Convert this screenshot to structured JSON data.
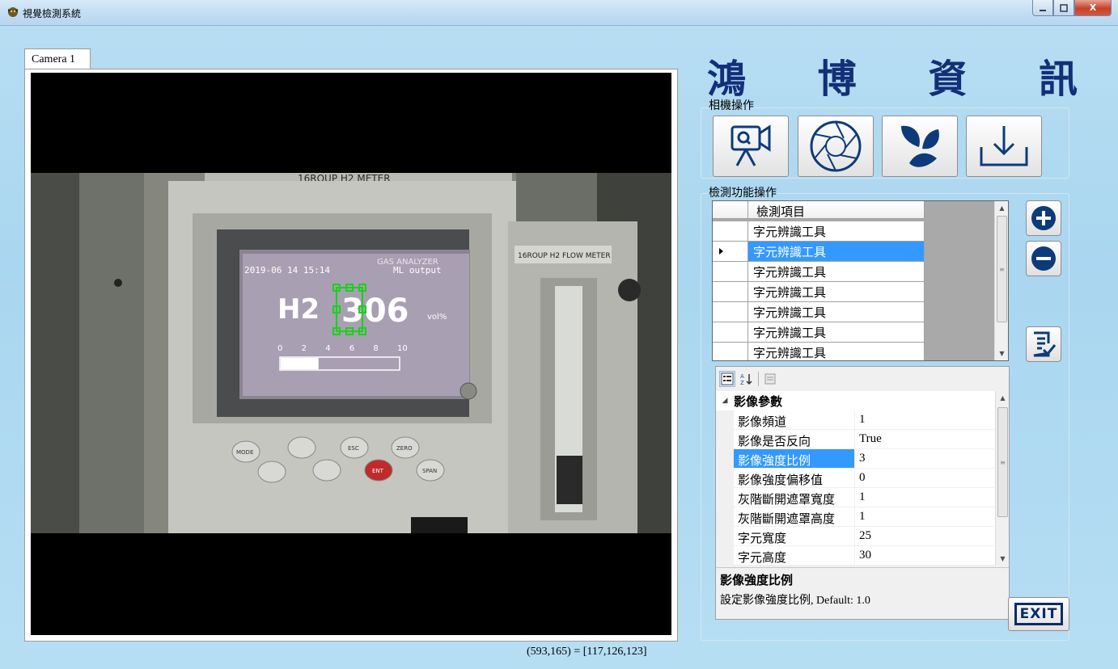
{
  "window": {
    "title": "視覺檢測系統",
    "minimize_icon": "minimize-icon",
    "maximize_icon": "maximize-icon",
    "close_label": "X"
  },
  "camera": {
    "tab_label": "Camera 1",
    "image": {
      "meter_top_label": "16ROUP H2 METER",
      "flow_meter_label": "16ROUP H2 FLOW METER",
      "analyzer_label": "GAS ANALYZER",
      "datetime": "2019-06 14 15:14",
      "output_label": "ML output",
      "gas": "H2",
      "reading": "306",
      "unit": "vol%",
      "scale_ticks": [
        "0",
        "2",
        "4",
        "6",
        "8",
        "10"
      ],
      "button_labels": [
        "MODE",
        "ESC",
        "ZERO",
        "ENT",
        "SPAN"
      ],
      "bar_fill_fraction": 0.32
    },
    "pixel_readout": "(593,165) = [117,126,123]"
  },
  "brand": {
    "chars": [
      "鴻",
      "博",
      "資",
      "訊"
    ]
  },
  "camera_ops": {
    "label": "相機操作",
    "buttons": [
      {
        "name": "live-camera-button",
        "icon": "video-camera-icon"
      },
      {
        "name": "aperture-button",
        "icon": "aperture-icon"
      },
      {
        "name": "capture-button",
        "icon": "shutter-icon"
      },
      {
        "name": "download-button",
        "icon": "download-icon"
      }
    ]
  },
  "detect_ops": {
    "label": "檢測功能操作",
    "column_header": "檢測項目",
    "rows": [
      "字元辨識工具",
      "字元辨識工具",
      "字元辨識工具",
      "字元辨識工具",
      "字元辨識工具",
      "字元辨識工具",
      "字元辨識工具"
    ],
    "selected_index": 1
  },
  "property_grid": {
    "category": "影像參數",
    "rows": [
      {
        "name": "影像頻道",
        "value": "1"
      },
      {
        "name": "影像是否反向",
        "value": "True"
      },
      {
        "name": "影像強度比例",
        "value": "3"
      },
      {
        "name": "影像強度偏移值",
        "value": "0"
      },
      {
        "name": "灰階斷開遮罩寬度",
        "value": "1"
      },
      {
        "name": "灰階斷開遮罩高度",
        "value": "1"
      },
      {
        "name": "字元寬度",
        "value": "25"
      },
      {
        "name": "字元高度",
        "value": "30"
      }
    ],
    "selected_index": 2,
    "description_title": "影像強度比例",
    "description_text": "設定影像強度比例, Default: 1.0"
  },
  "exit_label": "EXIT",
  "colors": {
    "brand": "#132f78",
    "selection": "#3399ff",
    "background": "#b0daf2"
  }
}
